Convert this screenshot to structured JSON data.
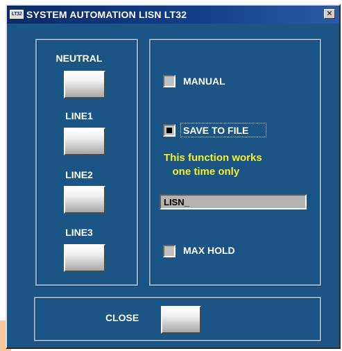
{
  "window": {
    "title": "SYSTEM AUTOMATION LISN LT32",
    "app_icon_text": "LT32",
    "close_glyph": "✕"
  },
  "lines": {
    "neutral_label": "NEUTRAL",
    "line1_label": "LINE1",
    "line2_label": "LINE2",
    "line3_label": "LINE3"
  },
  "options": {
    "manual": {
      "label": "MANUAL",
      "checked": false
    },
    "save_to_file": {
      "label": "SAVE TO  FILE",
      "checked": true
    },
    "note": "This function works\n   one time only",
    "filename_value": "LISN_",
    "max_hold": {
      "label": "MAX HOLD",
      "checked": false
    }
  },
  "footer": {
    "close_label": "CLOSE"
  },
  "colors": {
    "window_bg": "#1b5585",
    "note_text": "#f4ef2a",
    "titlebar_start": "#0b2a66",
    "titlebar_end": "#2c5aa6"
  }
}
